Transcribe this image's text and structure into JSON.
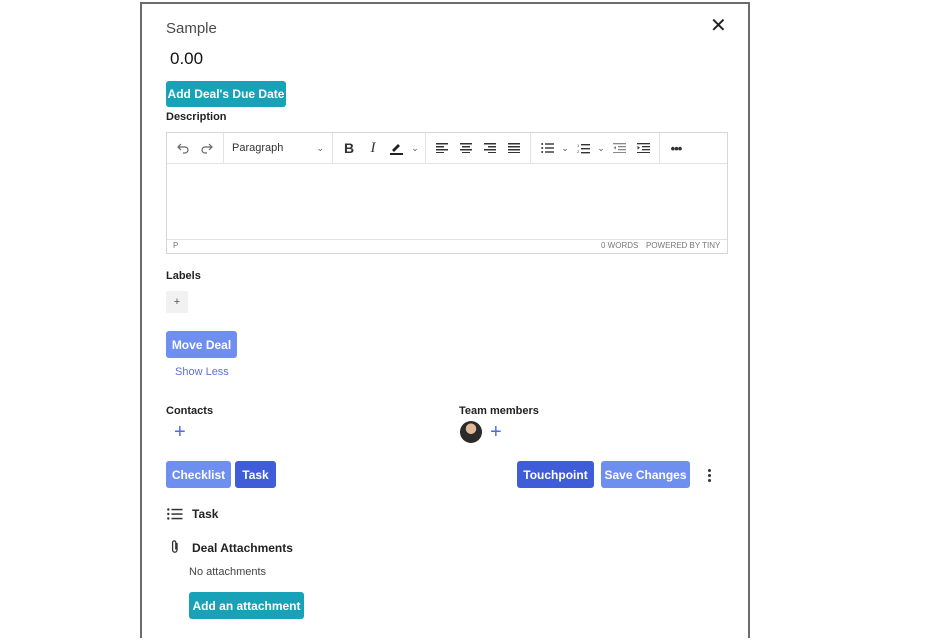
{
  "modal": {
    "title": "Sample",
    "amount": "0.00",
    "due_date_button": "Add Deal's Due Date",
    "description_label": "Description",
    "editor": {
      "format_select": "Paragraph",
      "status_path": "P",
      "status_words": "0 WORDS",
      "status_powered": "POWERED BY TINY"
    },
    "labels_label": "Labels",
    "labels_add": "+",
    "move_deal_button": "Move Deal",
    "show_less_link": "Show Less",
    "contacts_label": "Contacts",
    "team_members_label": "Team members",
    "checklist_button": "Checklist",
    "task_button": "Task",
    "touchpoint_button": "Touchpoint",
    "save_changes_button": "Save Changes",
    "task_section_title": "Task",
    "attachments_title": "Deal Attachments",
    "no_attachments_text": "No attachments",
    "add_attachment_button": "Add an attachment"
  },
  "colors": {
    "teal": "#17a2b8",
    "blue_light": "#6e8ff0",
    "blue_dark": "#3f5dd9",
    "link": "#5c6fd6"
  }
}
